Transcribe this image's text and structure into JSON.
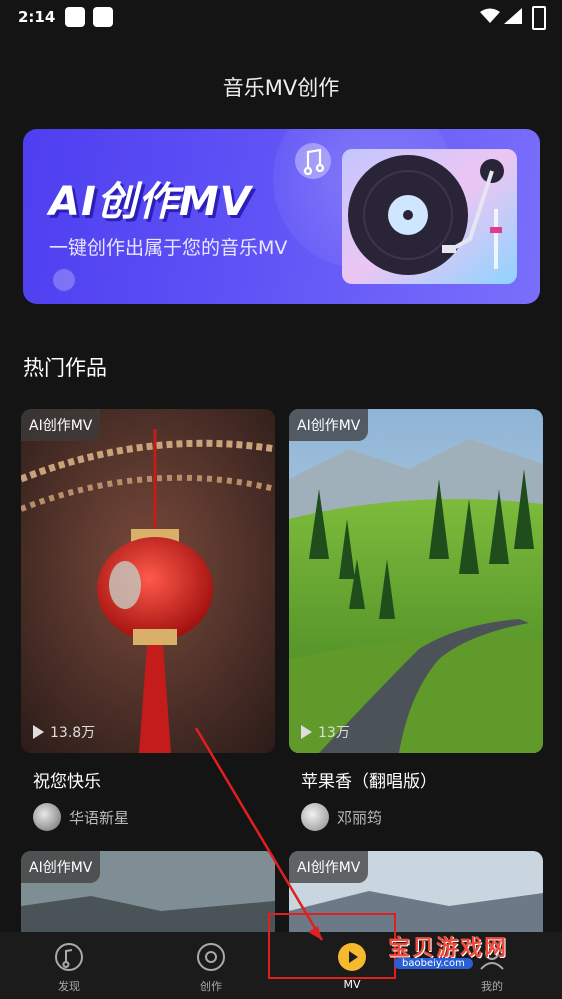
{
  "status_bar": {
    "time": "2:14"
  },
  "header": {
    "title": "音乐MV创作"
  },
  "banner": {
    "headline": "AI创作MV",
    "subtitle": "一键创作出属于您的音乐MV",
    "accent": "#5a4ef4"
  },
  "section": {
    "title": "热门作品"
  },
  "works": [
    {
      "tag": "AI创作MV",
      "plays": "13.8万",
      "title": "祝您快乐",
      "author": "华语新星"
    },
    {
      "tag": "AI创作MV",
      "plays": "13万",
      "title": "苹果香（翻唱版）",
      "author": "邓丽筠"
    },
    {
      "tag": "AI创作MV"
    },
    {
      "tag": "AI创作MV"
    }
  ],
  "tabbar": {
    "items": [
      {
        "label": "发现",
        "icon": "music-note-icon"
      },
      {
        "label": "创作",
        "icon": "disc-icon"
      },
      {
        "label": "MV",
        "icon": "play-icon",
        "active": true
      },
      {
        "label": "我的",
        "icon": "profile-icon"
      }
    ]
  },
  "watermark": {
    "text": "宝贝游戏网",
    "url": "baobeiy.com"
  }
}
